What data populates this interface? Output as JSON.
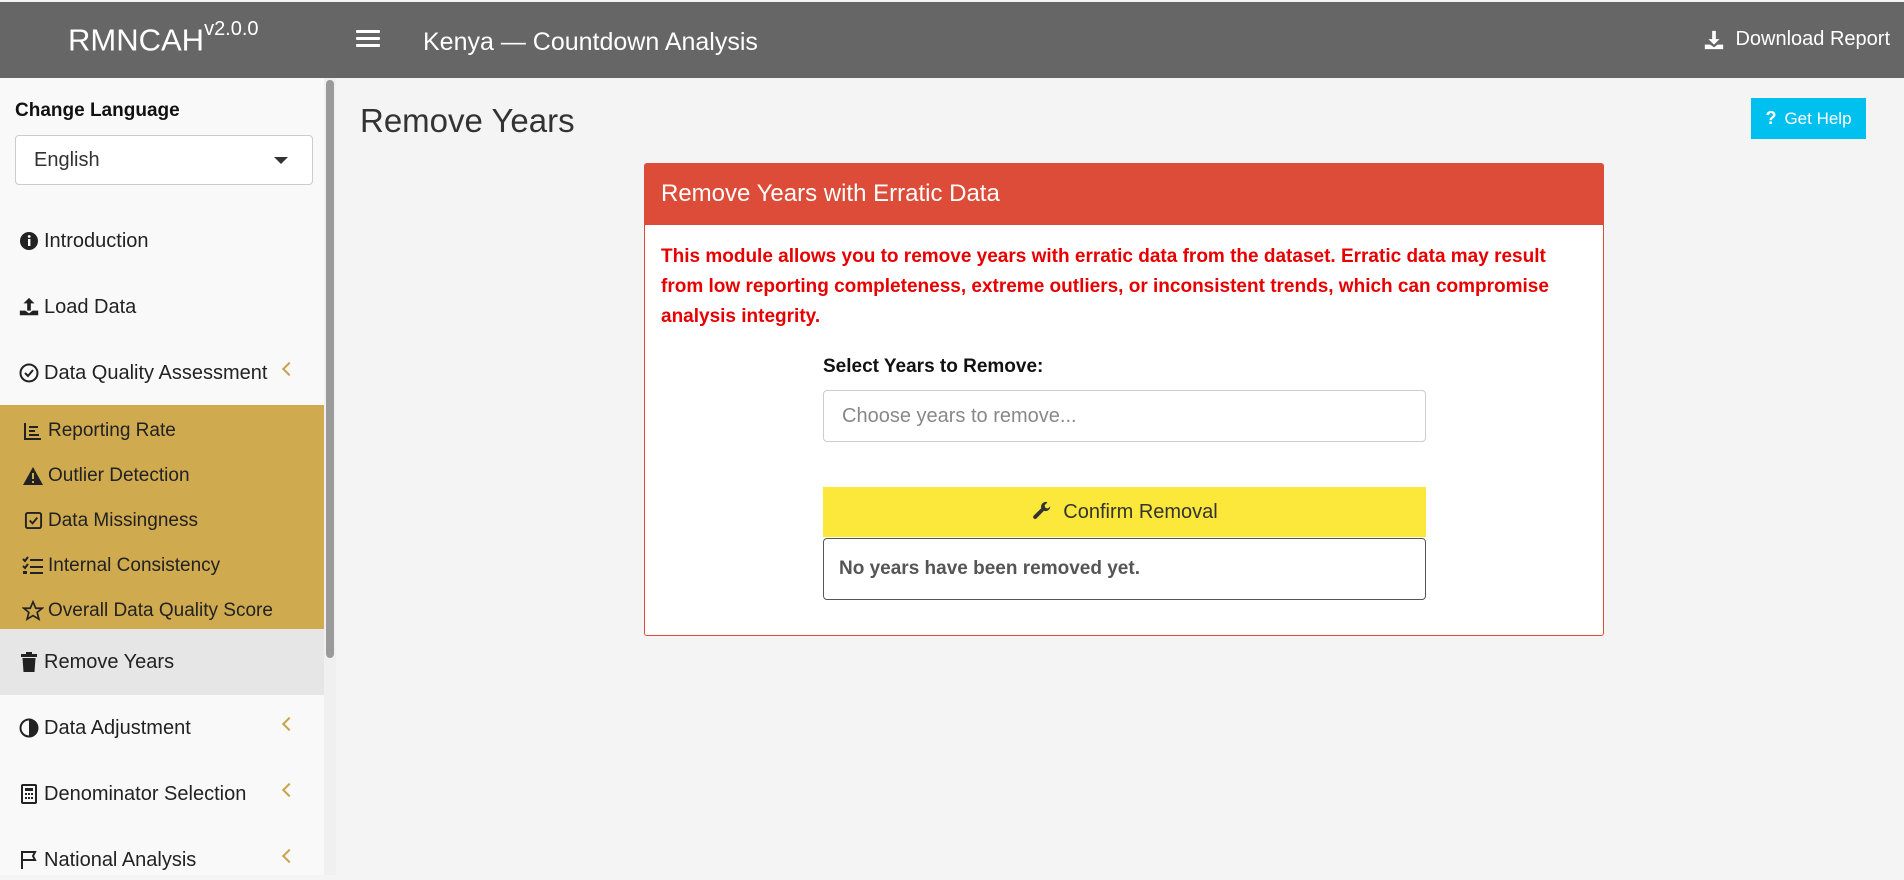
{
  "header": {
    "brand": "RMNCAH",
    "version": "v2.0.0",
    "title": "Kenya — Countdown Analysis",
    "download_label": "Download Report"
  },
  "sidebar": {
    "language_label": "Change Language",
    "language_value": "English",
    "items": [
      {
        "label": "Introduction",
        "icon": "info-circle-icon"
      },
      {
        "label": "Load Data",
        "icon": "upload-icon"
      },
      {
        "label": "Data Quality Assessment",
        "icon": "check-circle-icon"
      },
      {
        "label": "Remove Years",
        "icon": "trash-icon"
      },
      {
        "label": "Data Adjustment",
        "icon": "adjust-icon"
      },
      {
        "label": "Denominator Selection",
        "icon": "calculator-icon"
      },
      {
        "label": "National Analysis",
        "icon": "flag-icon"
      }
    ],
    "subitems": [
      {
        "label": "Reporting Rate",
        "icon": "chart-line-icon"
      },
      {
        "label": "Outlier Detection",
        "icon": "warning-icon"
      },
      {
        "label": "Data Missingness",
        "icon": "check-square-icon"
      },
      {
        "label": "Internal Consistency",
        "icon": "list-check-icon"
      },
      {
        "label": "Overall Data Quality Score",
        "icon": "star-icon"
      }
    ]
  },
  "main": {
    "page_title": "Remove Years",
    "help_label": "Get Help",
    "box_title": "Remove Years with Erratic Data",
    "description": "This module allows you to remove years with erratic data from the dataset. Erratic data may result from low reporting completeness, extreme outliers, or inconsistent trends, which can compromise analysis integrity.",
    "select_label": "Select Years to Remove:",
    "select_placeholder": "Choose years to remove...",
    "confirm_label": "Confirm Removal",
    "status_text": "No years have been removed yet."
  },
  "colors": {
    "topbar": "#666666",
    "accent_gold": "#cfaa4f",
    "box_red": "#dd4b39",
    "help_cyan": "#00c0ef",
    "confirm_yellow": "#fce83a"
  }
}
